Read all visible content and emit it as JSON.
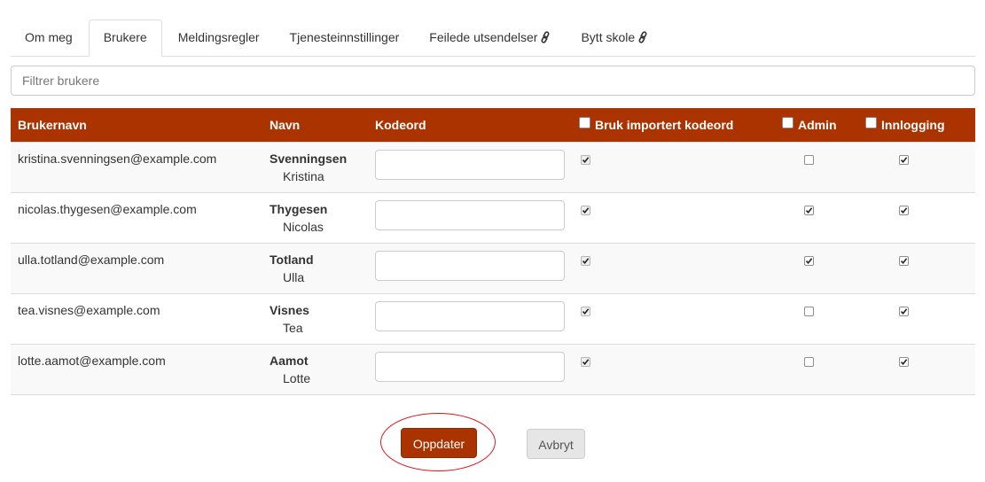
{
  "tabs": [
    {
      "label": "Om meg",
      "active": false,
      "link_icon": false
    },
    {
      "label": "Brukere",
      "active": true,
      "link_icon": false
    },
    {
      "label": "Meldingsregler",
      "active": false,
      "link_icon": false
    },
    {
      "label": "Tjenesteinnstillinger",
      "active": false,
      "link_icon": false
    },
    {
      "label": "Feilede utsendelser",
      "active": false,
      "link_icon": true
    },
    {
      "label": "Bytt skole",
      "active": false,
      "link_icon": true
    }
  ],
  "filter": {
    "placeholder": "Filtrer brukere",
    "value": ""
  },
  "table": {
    "headers": {
      "username": "Brukernavn",
      "name": "Navn",
      "password": "Kodeord",
      "use_imported": "Bruk importert kodeord",
      "admin": "Admin",
      "login": "Innlogging"
    },
    "rows": [
      {
        "username": "kristina.svenningsen@example.com",
        "last": "Svenningsen",
        "first": "Kristina",
        "password": "",
        "use_imported": true,
        "admin": false,
        "login": true
      },
      {
        "username": "nicolas.thygesen@example.com",
        "last": "Thygesen",
        "first": "Nicolas",
        "password": "",
        "use_imported": true,
        "admin": true,
        "login": true
      },
      {
        "username": "ulla.totland@example.com",
        "last": "Totland",
        "first": "Ulla",
        "password": "",
        "use_imported": true,
        "admin": true,
        "login": true
      },
      {
        "username": "tea.visnes@example.com",
        "last": "Visnes",
        "first": "Tea",
        "password": "",
        "use_imported": true,
        "admin": false,
        "login": true
      },
      {
        "username": "lotte.aamot@example.com",
        "last": "Aamot",
        "first": "Lotte",
        "password": "",
        "use_imported": true,
        "admin": false,
        "login": true
      }
    ]
  },
  "buttons": {
    "update": "Oppdater",
    "cancel": "Avbryt"
  },
  "colors": {
    "accent": "#ab3300",
    "highlight_ring": "#e0141c"
  }
}
